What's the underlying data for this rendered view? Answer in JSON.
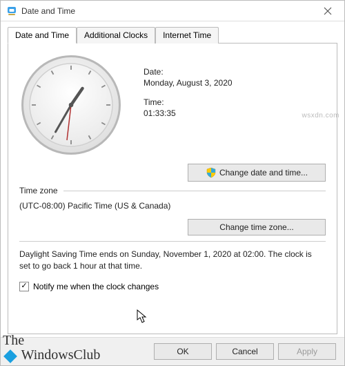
{
  "window": {
    "title": "Date and Time"
  },
  "tabs": {
    "datetime": "Date and Time",
    "additional": "Additional Clocks",
    "internet": "Internet Time"
  },
  "datetime": {
    "date_label": "Date:",
    "date_value": "Monday, August 3, 2020",
    "time_label": "Time:",
    "time_value": "01:33:35",
    "change_dt_btn": "Change date and time..."
  },
  "timezone": {
    "header": "Time zone",
    "value": "(UTC-08:00) Pacific Time (US & Canada)",
    "change_tz_btn": "Change time zone..."
  },
  "dst": {
    "text": "Daylight Saving Time ends on Sunday, November 1, 2020 at 02:00. The clock is set to go back 1 hour at that time.",
    "notify_label": "Notify me when the clock changes",
    "notify_checked": true
  },
  "buttons": {
    "ok": "OK",
    "cancel": "Cancel",
    "apply": "Apply"
  },
  "watermark": {
    "line1": "The",
    "line2": " WindowsClub",
    "site": "wsxdn.com"
  }
}
